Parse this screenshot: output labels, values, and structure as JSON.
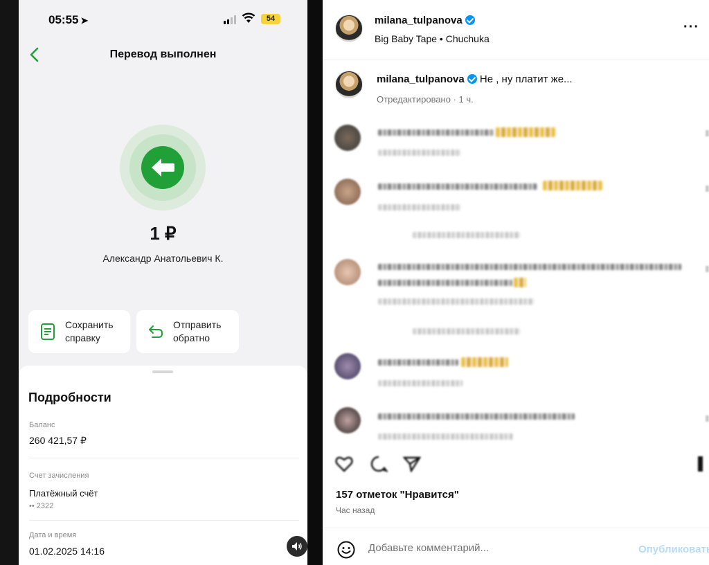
{
  "phone": {
    "status": {
      "time": "05:55",
      "battery": "54"
    },
    "nav": {
      "title": "Перевод выполнен"
    },
    "transfer": {
      "amount": "1 ₽",
      "recipient": "Александр Анатольевич К."
    },
    "actions": [
      {
        "label": "Сохранить справку",
        "icon": "document-icon"
      },
      {
        "label": "Отправить обратно",
        "icon": "return-arrow-icon"
      }
    ],
    "details": {
      "title": "Подробности",
      "balance_label": "Баланс",
      "balance_value": "260 421,57 ₽",
      "account_label": "Счет зачисления",
      "account_value": "Платёжный счёт",
      "account_sub": "•• 2322",
      "date_label": "Дата и время",
      "date_value": "01.02.2025 14:16"
    },
    "colors": {
      "brand_green": "#21a038",
      "background": "#f2f2f4"
    }
  },
  "instagram": {
    "header": {
      "username": "milana_tulpanova",
      "music": "Big Baby Tape • Chuchuka",
      "more_icon": "more-dots-icon"
    },
    "caption": {
      "username": "milana_tulpanova",
      "text": "Не , ну платит же...",
      "meta": "Отредактировано · 1 ч."
    },
    "likes": "157 отметок \"Нравится\"",
    "time_ago": "Час назад",
    "comment_bar": {
      "placeholder": "Добавьте комментарий...",
      "publish_label": "Опубликовать"
    },
    "colors": {
      "verified": "#0095f6",
      "publish_disabled": "#b6dcf9"
    }
  }
}
